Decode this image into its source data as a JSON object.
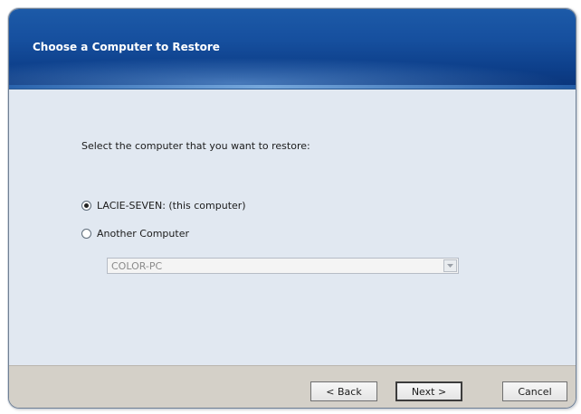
{
  "window": {
    "title": "Choose a Computer to Restore"
  },
  "main": {
    "prompt": "Select the computer that you want to restore:",
    "options": [
      {
        "label": "LACIE-SEVEN: (this computer)",
        "selected": true
      },
      {
        "label": "Another Computer",
        "selected": false
      }
    ],
    "computer_select": {
      "value": "COLOR-PC",
      "enabled": false
    }
  },
  "footer": {
    "back_label": "< Back",
    "next_label": "Next >",
    "cancel_label": "Cancel"
  },
  "colors": {
    "banner": "#164f9e",
    "content_bg": "#e1e8f1",
    "footer_bg": "#d4d0c8"
  }
}
